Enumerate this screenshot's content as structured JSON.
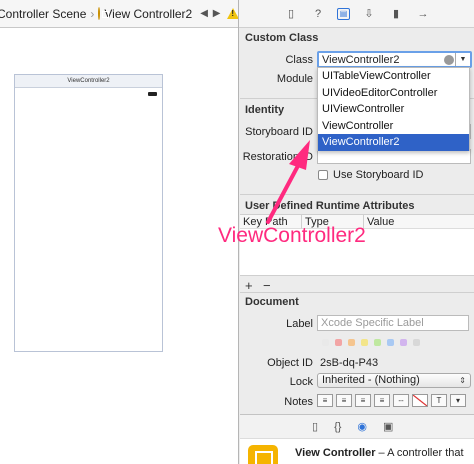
{
  "jumpbar": {
    "scene": "Controller Scene",
    "controller": "View Controller2",
    "nav_arrows": "◀ ▶"
  },
  "scene": {
    "title": "ViewController2"
  },
  "inspector_tabs": [
    "file-icon",
    "help-icon",
    "identity-icon",
    "attributes-icon",
    "size-icon",
    "connections-icon"
  ],
  "custom_class": {
    "title": "Custom Class",
    "class_label": "Class",
    "class_value": "ViewController2",
    "module_label": "Module",
    "options": [
      "UITableViewController",
      "UIVideoEditorController",
      "UIViewController",
      "ViewController",
      "ViewController2"
    ],
    "selected_option": "ViewController2"
  },
  "identity": {
    "title": "Identity",
    "storyboard_id_label": "Storyboard ID",
    "restoration_label": "Restoration ID",
    "use_storyboard_id_label": "Use Storyboard ID"
  },
  "udra": {
    "title": "User Defined Runtime Attributes",
    "columns": [
      "Key Path",
      "Type",
      "Value"
    ],
    "add": "+",
    "remove": "−"
  },
  "document": {
    "title": "Document",
    "label_label": "Label",
    "label_placeholder": "Xcode Specific Label",
    "label_colors": [
      "#e9e9e9",
      "#f2a5a5",
      "#f5c58f",
      "#f3e58a",
      "#bfe8a0",
      "#a9c9f3",
      "#d2b5ee",
      "#d8d8d8"
    ],
    "object_id_label": "Object ID",
    "object_id_value": "2sB-dq-P43",
    "lock_label": "Lock",
    "lock_value": "Inherited - (Nothing)",
    "notes_label": "Notes"
  },
  "library": {
    "tabs": [
      "file-template-icon",
      "code-snippet-icon",
      "object-library-icon",
      "media-library-icon"
    ],
    "item_title": "View Controller",
    "item_desc": " – A controller that"
  },
  "callout": {
    "text": "ViewController2",
    "color": "#ff2a7f"
  }
}
